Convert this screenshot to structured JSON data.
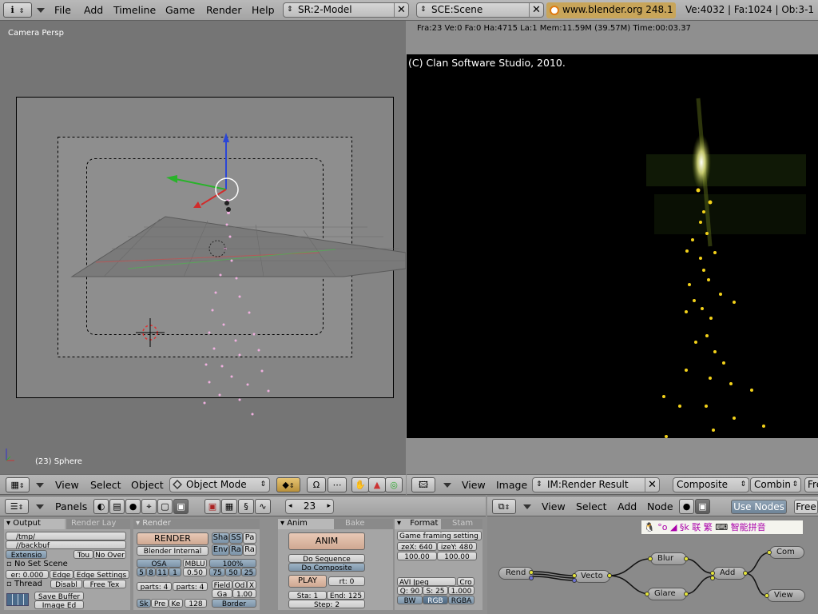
{
  "topbar": {
    "menus": [
      "File",
      "Add",
      "Timeline",
      "Game",
      "Render",
      "Help"
    ],
    "screen_field": "SR:2-Model",
    "scene_field": "SCE:Scene",
    "url_text": "www.blender.org 248.1",
    "stats": "Ve:4032 | Fa:1024 | Ob:3-1"
  },
  "viewport": {
    "view_label": "Camera Persp",
    "object_label": "(23) Sphere",
    "header": {
      "menus": [
        "View",
        "Select",
        "Object"
      ],
      "mode": "Object Mode"
    }
  },
  "render": {
    "info": "Fra:23  Ve:0 Fa:0 Ha:4715 La:1 Mem:11.59M (39.57M) Time:00:03.37",
    "copyright": "(C) Clan Software Studio, 2010.",
    "header": {
      "menus": [
        "View",
        "Image"
      ],
      "image_field": "IM:Render Result",
      "pass_select": "Composite",
      "layer_select": "Combin",
      "extra": "Free"
    }
  },
  "buttons_header": {
    "panels_label": "Panels",
    "frame": "23"
  },
  "node_header": {
    "menus": [
      "View",
      "Select",
      "Add",
      "Node"
    ],
    "use_nodes": "Use Nodes",
    "free": "Free",
    "ime_text": "智能拼音",
    "ime_chars": "联 繁"
  },
  "output_panel": {
    "tabs": [
      "Output",
      "Render Lay"
    ],
    "path1": "/tmp/",
    "path2": "//backbuf",
    "extensions": "Extensio",
    "touch": "Tou",
    "no_overwrite": "No Over",
    "set_scene": "No Set Scene",
    "edge": "er: 0.000",
    "edge_btn": "Edge",
    "edge_settings": "Edge Settings",
    "threads": "Thread",
    "disable": "Disabl",
    "free_tex": "Free Tex",
    "save_buffers": "Save Buffer",
    "image_editor": "Image Ed"
  },
  "render_panel": {
    "tab": "Render",
    "render_btn": "RENDER",
    "engine": "Blender Internal",
    "sha": "Sha",
    "ss": "SS",
    "pa": "Pa",
    "env": "Env",
    "ra": "Ra",
    "ra2": "Ra",
    "osa": "OSA",
    "mblur": "MBLU",
    "pct": "100%",
    "osa_vals": [
      "5",
      "8",
      "11",
      "1"
    ],
    "mblur_val": "0.50",
    "pct_vals": [
      "75",
      "50",
      "25"
    ],
    "parts_x": "parts: 4",
    "parts_y": "parts: 4",
    "field": "Field",
    "od": "Od",
    "x": "X",
    "gauss": "Ga",
    "gauss_val": "1.00",
    "sk": "Sk",
    "pre": "Pre",
    "ke": "Ke",
    "size": "128",
    "border": "Border"
  },
  "anim_panel": {
    "tab": "Anim",
    "tab2": "Bake",
    "anim": "ANIM",
    "do_sequence": "Do Sequence",
    "do_composite": "Do Composite",
    "play": "PLAY",
    "rt": "rt: 0",
    "sta": "Sta: 1",
    "end": "End: 125",
    "step": "Step: 2"
  },
  "format_panel": {
    "tab": "Format",
    "tab2": "Stam",
    "preset": "Game framing setting",
    "sizex": "zeX: 640",
    "sizey": "izeY: 480",
    "aspx": "100.00",
    "aspy": "100.00",
    "codec": "AVI Jpeg",
    "crop": "Cro",
    "quality": "Q: 90",
    "fps": "S: 25",
    "fps2": "1.000",
    "bw": "BW",
    "rgb": "RGB",
    "rgba": "RGBA"
  },
  "nodes": [
    {
      "label": "Rend"
    },
    {
      "label": "Vecto"
    },
    {
      "label": "Blur"
    },
    {
      "label": "Glare"
    },
    {
      "label": "Add"
    },
    {
      "label": "Com"
    },
    {
      "label": "View"
    }
  ]
}
